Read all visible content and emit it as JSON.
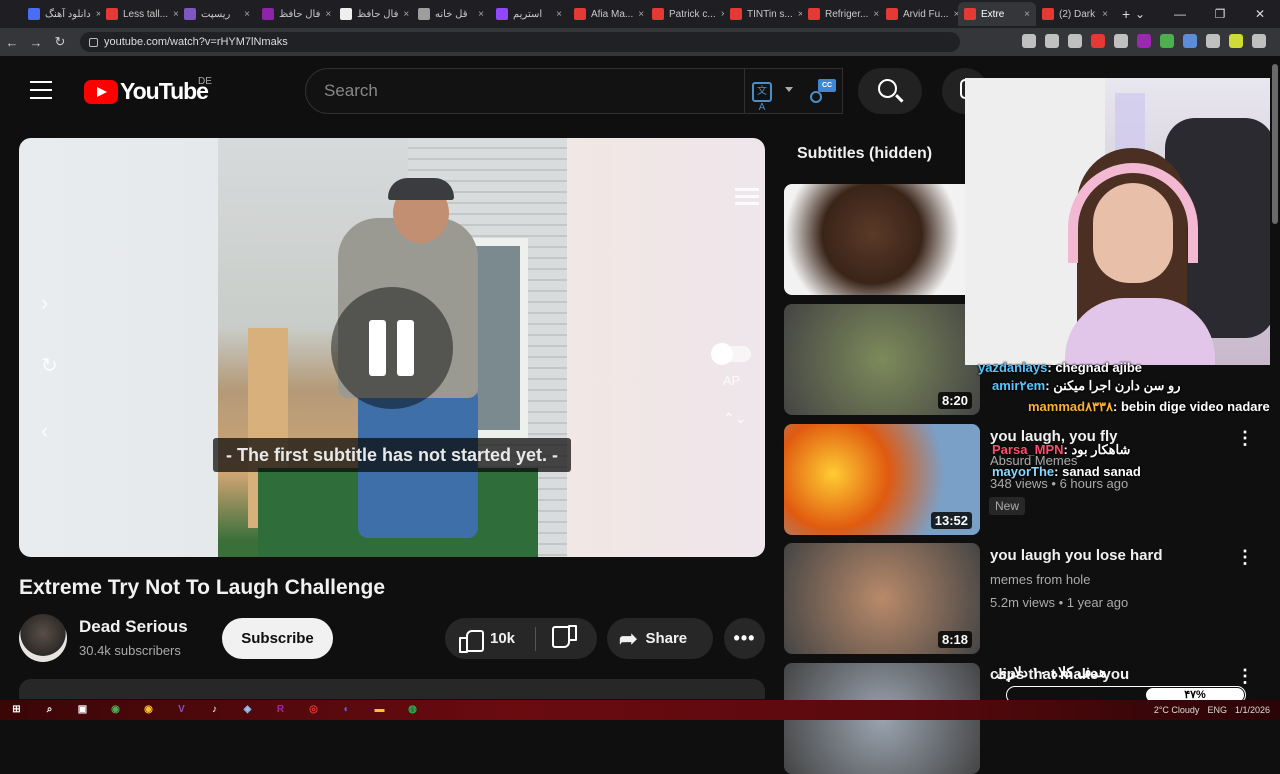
{
  "browser": {
    "tabs": [
      {
        "label": "دانلود آهنگ",
        "color": "#4a6cf7",
        "active": false
      },
      {
        "label": "Less tall...",
        "color": "#e53935",
        "active": false
      },
      {
        "label": "ریسپت",
        "color": "#7e57c2",
        "active": false
      },
      {
        "label": "فال حافظ",
        "color": "#8e24aa",
        "active": false
      },
      {
        "label": "فال حافظ",
        "color": "#eeeeee",
        "active": false
      },
      {
        "label": "قل خانه",
        "color": "#9e9e9e",
        "active": false
      },
      {
        "label": "استریم",
        "color": "#9146ff",
        "active": false
      },
      {
        "label": "Afia Ma...",
        "color": "#e53935",
        "active": false
      },
      {
        "label": "Patrick c...",
        "color": "#e53935",
        "active": false
      },
      {
        "label": "TINTin s...",
        "color": "#e53935",
        "active": false
      },
      {
        "label": "Refriger...",
        "color": "#e53935",
        "active": false
      },
      {
        "label": "Arvid Fu...",
        "color": "#e53935",
        "active": false
      },
      {
        "label": "Extre",
        "color": "#e53935",
        "active": true
      },
      {
        "label": "(2) Dark",
        "color": "#e53935",
        "active": false
      }
    ],
    "new_tab": "+",
    "url": "youtube.com/watch?v=rHYM7lNmaks",
    "window_controls": [
      "⌄",
      "—",
      "❐",
      "✕"
    ],
    "ext_colors": [
      "#c0c0c0",
      "#c0c0c0",
      "#c0c0c0",
      "#e53935",
      "#c0c0c0",
      "#9c27b0",
      "#4caf50",
      "#5b8dd9",
      "#c0c0c0",
      "#cddc39",
      "#c0c0c0"
    ]
  },
  "header": {
    "logo_word": "YouTube",
    "country": "DE",
    "search_placeholder": "Search",
    "kbd_glyph": "文A",
    "cc_label": "CC"
  },
  "player": {
    "subtitle_text": "- The first subtitle has not started yet. -",
    "ap_label": "AP",
    "controls": {
      "next": "›",
      "replay": "↻",
      "prev": "‹",
      "up_down": "⌃⌄"
    }
  },
  "video": {
    "title": "Extreme Try Not To Laugh Challenge",
    "channel_name": "Dead Serious",
    "subscribers": "30.4k subscribers",
    "subscribe_label": "Subscribe",
    "likes": "10k",
    "share_label": "Share",
    "more_label": "•••"
  },
  "sidebar": {
    "subtitles_heading": "Subtitles (hidden)",
    "recommendations": [
      {
        "title": "",
        "channel": "",
        "meta": "",
        "duration": "",
        "thumb_color": "#f0f0f0"
      },
      {
        "title": "",
        "channel": "",
        "meta": "",
        "duration": "8:20",
        "thumb_color": "#7d8a5a"
      },
      {
        "title": "you laugh, you fly",
        "channel": "Absurd Memes",
        "meta": "348 views • 6 hours ago",
        "duration": "13:52",
        "badge": "New",
        "thumb_color": "#c8481a"
      },
      {
        "title": "you laugh you lose hard",
        "channel": "memes from hole",
        "meta": "5.2m views • 1 year ago",
        "duration": "8:18",
        "thumb_color": "#b98a6a"
      },
      {
        "title": "clips that make you",
        "channel": "",
        "meta": "",
        "duration": "",
        "thumb_color": "#9aa4b0"
      }
    ]
  },
  "stream_overlay": {
    "chat": [
      {
        "user": "yazdanlays",
        "msg": "chegnad ajibe"
      },
      {
        "user": "amir۲em",
        "msg": "رو سن دارن اجرا میکنن"
      },
      {
        "user": "mammad۸۳۳۸",
        "msg": "bebin dige video nadare=))"
      },
      {
        "user": "Parsa_MPN",
        "msg": "شاهکار بود"
      },
      {
        "user": "mayorThe",
        "msg": "sanad sanad"
      }
    ],
    "goal_text": "هدف کلاه ۱۰ دلاری",
    "goal_percent": "۴۷%",
    "goal_progress": 0.47
  },
  "taskbar": {
    "icons": [
      {
        "name": "windows-start-icon",
        "color": "#ffffff",
        "glyph": "⊞"
      },
      {
        "name": "search-icon",
        "color": "#ffffff",
        "glyph": "⌕"
      },
      {
        "name": "task-view-icon",
        "color": "#ffffff",
        "glyph": "▣"
      },
      {
        "name": "chrome-icon",
        "color": "#4caf50",
        "glyph": "◉"
      },
      {
        "name": "chrome-active-icon",
        "color": "#fbc02d",
        "glyph": "◉"
      },
      {
        "name": "vscode-icon",
        "color": "#7e57c2",
        "glyph": "V"
      },
      {
        "name": "tiktok-icon",
        "color": "#ffffff",
        "glyph": "♪"
      },
      {
        "name": "steam-icon",
        "color": "#90caf9",
        "glyph": "◈"
      },
      {
        "name": "r-app-icon",
        "color": "#9c27b0",
        "glyph": "R"
      },
      {
        "name": "obs-icon",
        "color": "#e53935",
        "glyph": "◎"
      },
      {
        "name": "discord-icon",
        "color": "#5865f2",
        "glyph": "◐"
      },
      {
        "name": "folder-icon",
        "color": "#fbc02d",
        "glyph": "▬"
      },
      {
        "name": "spotify-icon",
        "color": "#1db954",
        "glyph": "◍"
      }
    ],
    "weather": "2°C Cloudy",
    "lang": "ENG",
    "date": "1/1/2026"
  }
}
